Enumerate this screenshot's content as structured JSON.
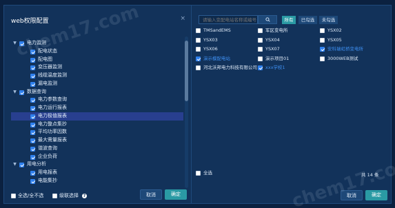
{
  "left": {
    "title": "web权限配置",
    "close_glyph": "×",
    "tree": [
      {
        "label": "电力监测",
        "level": 0,
        "expanded": true,
        "checked": true,
        "selected": false
      },
      {
        "label": "配电状态",
        "level": 1,
        "checked": true,
        "selected": false
      },
      {
        "label": "配电图",
        "level": 1,
        "checked": true,
        "selected": false
      },
      {
        "label": "变压器监测",
        "level": 1,
        "checked": true,
        "selected": false
      },
      {
        "label": "线缆温度监测",
        "level": 1,
        "checked": true,
        "selected": false
      },
      {
        "label": "漏电监测",
        "level": 1,
        "checked": true,
        "selected": false
      },
      {
        "label": "数据查询",
        "level": 0,
        "expanded": true,
        "checked": true,
        "selected": false
      },
      {
        "label": "电力参数查询",
        "level": 1,
        "checked": true,
        "selected": false
      },
      {
        "label": "电力运行报表",
        "level": 1,
        "checked": true,
        "selected": false
      },
      {
        "label": "电力极值报表",
        "level": 1,
        "checked": true,
        "selected": true
      },
      {
        "label": "电力整点集抄",
        "level": 1,
        "checked": true,
        "selected": false
      },
      {
        "label": "平均功率因数",
        "level": 1,
        "checked": true,
        "selected": false
      },
      {
        "label": "最大需量报表",
        "level": 1,
        "checked": true,
        "selected": false
      },
      {
        "label": "谐波查询",
        "level": 1,
        "checked": true,
        "selected": false
      },
      {
        "label": "企业负荷",
        "level": 1,
        "checked": true,
        "selected": false
      },
      {
        "label": "用电分析",
        "level": 0,
        "expanded": true,
        "checked": true,
        "selected": false
      },
      {
        "label": "用电报表",
        "level": 1,
        "checked": true,
        "selected": false
      },
      {
        "label": "电能集抄",
        "level": 1,
        "checked": true,
        "selected": false
      }
    ],
    "footer": {
      "select_all_label": "全选/全不选",
      "cascade_label": "级联选择",
      "help_glyph": "?"
    },
    "cancel_label": "取消",
    "ok_label": "确定"
  },
  "right": {
    "search": {
      "placeholder": "请输入变配电站名称或编号"
    },
    "filters": [
      {
        "label": "所有",
        "active": true
      },
      {
        "label": "已勾选",
        "active": false
      },
      {
        "label": "未勾选",
        "active": false
      }
    ],
    "stations": [
      {
        "label": "TMSandEMS",
        "checked": false,
        "highlight": false
      },
      {
        "label": "军区变电所",
        "checked": false,
        "highlight": false
      },
      {
        "label": "YSX02",
        "checked": false,
        "highlight": false
      },
      {
        "label": "YSX03",
        "checked": false,
        "highlight": false
      },
      {
        "label": "YSX04",
        "checked": false,
        "highlight": false
      },
      {
        "label": "YSX05",
        "checked": false,
        "highlight": false
      },
      {
        "label": "YSX06",
        "checked": false,
        "highlight": false
      },
      {
        "label": "YSX07",
        "checked": false,
        "highlight": false
      },
      {
        "label": "安科瑞虹桥变电所",
        "checked": true,
        "highlight": true
      },
      {
        "label": "演示模配电站",
        "checked": true,
        "highlight": true
      },
      {
        "label": "演示项目01",
        "checked": false,
        "highlight": false
      },
      {
        "label": "3000WEB测试",
        "checked": false,
        "highlight": false
      },
      {
        "label": "河北沃邦电力科技有限公司",
        "checked": false,
        "highlight": false
      },
      {
        "label": "xxx学校1",
        "checked": true,
        "highlight": true
      }
    ],
    "select_all_label": "全选",
    "total_label": "共 14 条",
    "cancel_label": "取消",
    "ok_label": "确定"
  },
  "watermark_text": "chem17.com",
  "colors": {
    "background": "#0b2140",
    "panel": "#12325a",
    "accent_teal": "#2a9aa4",
    "checkbox_blue": "#2f80ed",
    "selected_row": "#283f8f",
    "highlight_text": "#3d8ef0"
  }
}
